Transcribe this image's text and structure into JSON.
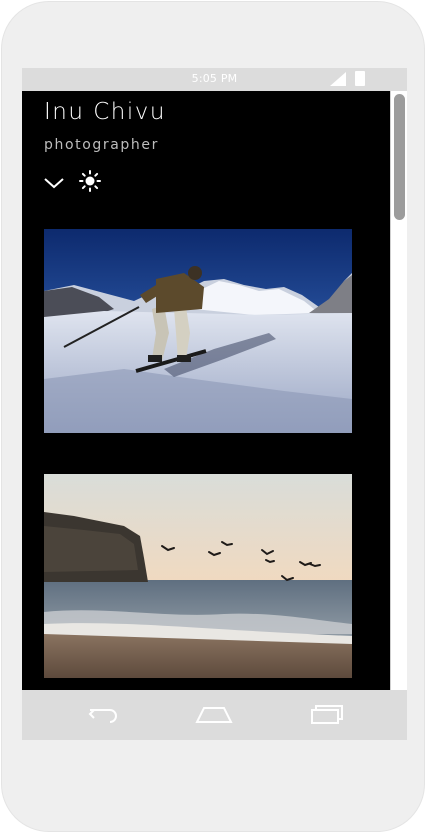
{
  "status_bar": {
    "time": "5:05 PM"
  },
  "profile": {
    "name": "Inu Chivu",
    "subtitle": "photographer"
  },
  "actions": {
    "expand_icon": "chevron-down-icon",
    "theme_icon": "sun-icon"
  },
  "photos": [
    {
      "subject": "skier on a snowy mountain slope"
    },
    {
      "subject": "birds flying over a beach at sunset"
    }
  ],
  "nav_bar": {
    "icons": [
      "back-icon",
      "home-icon",
      "recent-apps-icon"
    ]
  },
  "colors": {
    "screen_bg": "#000000",
    "frame": "#efefef",
    "bars": "#dcdcdc",
    "text": "#ffffff"
  }
}
